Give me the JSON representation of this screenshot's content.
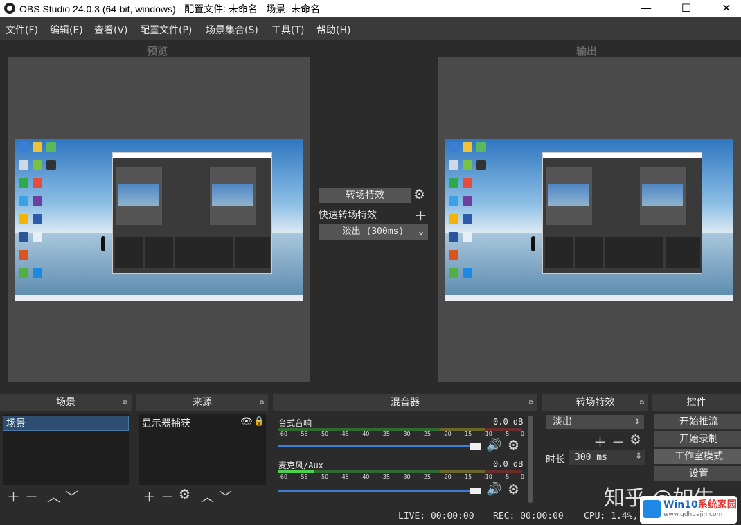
{
  "window": {
    "title": "OBS Studio 24.0.3 (64-bit, windows) - 配置文件: 未命名 - 场景: 未命名",
    "minimize": "—",
    "maximize": "☐",
    "close": "✕"
  },
  "menu": [
    "文件(F)",
    "编辑(E)",
    "查看(V)",
    "配置文件(P)",
    "场景集合(S)",
    "工具(T)",
    "帮助(H)"
  ],
  "preview_label": "预览",
  "output_label": "输出",
  "transition_center": {
    "button": "转场特效",
    "quick": "快速转场特效",
    "selected": "淡出 (300ms)"
  },
  "docks": {
    "scenes": "场景",
    "sources": "来源",
    "mixer": "混音器",
    "transitions": "转场特效",
    "controls": "控件"
  },
  "scenes": {
    "items": [
      "场景"
    ]
  },
  "sources": {
    "items": [
      "显示器捕获"
    ]
  },
  "mixer": {
    "channels": [
      {
        "name": "台式音响",
        "db": "0.0 dB"
      },
      {
        "name": "麦克风/Aux",
        "db": "0.0 dB"
      }
    ],
    "scale": [
      "-60",
      "-55",
      "-50",
      "-45",
      "-40",
      "-35",
      "-30",
      "-25",
      "-20",
      "-15",
      "-10",
      "-5",
      "0"
    ]
  },
  "transitions": {
    "selected": "淡出",
    "duration_label": "时长",
    "duration_value": "300 ms"
  },
  "controls": [
    "开始推流",
    "开始录制",
    "工作室模式",
    "设置"
  ],
  "status": {
    "live": "LIVE: 00:00:00",
    "rec": "REC: 00:00:00",
    "cpu": "CPU: 1.4%,"
  },
  "watermark": "知乎 @如生",
  "logo": {
    "brand": "Win10",
    "name": "系统家园",
    "url": "www.qdhuajin.com"
  }
}
